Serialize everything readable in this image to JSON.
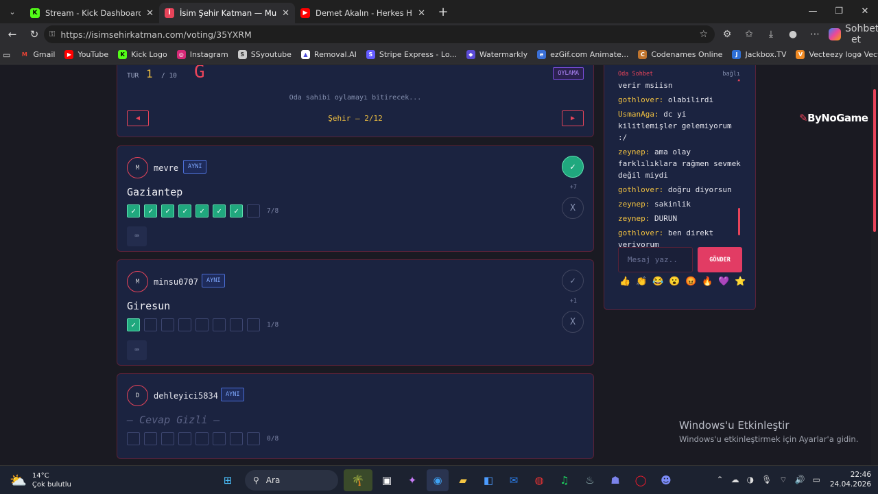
{
  "browser": {
    "tabs": [
      {
        "title": "Stream - Kick Dashboard",
        "icon": "kick-icon",
        "color": "#53fc18"
      },
      {
        "title": "İsim Şehir Katman — Multiplayer K",
        "icon": "site-icon",
        "color": "#e8445a"
      },
      {
        "title": "Demet Akalın - Herkes Hak Ettiği G",
        "icon": "youtube-icon",
        "color": "#ff0000"
      }
    ],
    "url": "https://isimsehirkatman.com/voting/35YXRM",
    "copilot_label": "Sohbet et",
    "bookmarks": [
      "Gmail",
      "YouTube",
      "Kick Logo",
      "Instagram",
      "SSyoutube",
      "Removal.AI",
      "Stripe Express - Lo...",
      "Watermarkly",
      "ezGif.com Animate...",
      "Codenames Online",
      "Jackbox.TV",
      "Vecteezy logo Vect..."
    ]
  },
  "game": {
    "round_label": "TUR",
    "round_current": "1",
    "round_total": "/ 10",
    "letter": "G",
    "phase": "OYLAMA",
    "waiting_text": "Oda sahibi oylamayı bitirecek...",
    "prev_arrow": "◀",
    "next_arrow": "▶",
    "category": "Şehir — 2/12"
  },
  "players": [
    {
      "initial": "M",
      "name": "mevre",
      "badge": "AYNI",
      "answer": "Gaziantep",
      "votes_yes": 7,
      "score": "7/8",
      "plus": "+7",
      "yes_active": true,
      "hidden": false
    },
    {
      "initial": "M",
      "name": "minsu0707",
      "badge": "AYNI",
      "answer": "Giresun",
      "votes_yes": 1,
      "score": "1/8",
      "plus": "+1",
      "yes_active": false,
      "hidden": false
    },
    {
      "initial": "D",
      "name": "dehleyici5834",
      "badge": "AYNI",
      "answer": "— Cevap Gizli —",
      "votes_yes": 0,
      "score": "0/8",
      "plus": "",
      "yes_active": false,
      "hidden": true
    }
  ],
  "vote_yes_symbol": "✓",
  "vote_no_symbol": "X",
  "keyboard_icon": "⌨",
  "chat": {
    "title": "Oda Sohbet",
    "status": "bağlı",
    "messages": [
      {
        "user": "",
        "text": "verir msiisn"
      },
      {
        "user": "gothlover:",
        "text": "olabilirdi"
      },
      {
        "user": "UsmanAga:",
        "text": "dc yi kilitlemişler gelemiyorum :/"
      },
      {
        "user": "zeynep:",
        "text": "ama olay farklılıklara rağmen sevmek değil miydi"
      },
      {
        "user": "gothlover:",
        "text": "doğru diyorsun"
      },
      {
        "user": "zeynep:",
        "text": "sakinlik"
      },
      {
        "user": "zeynep:",
        "text": "DURUN"
      },
      {
        "user": "gothlover:",
        "text": "ben direkt veriyorum"
      }
    ],
    "input_placeholder": "Mesaj yaz..",
    "send_label": "GÖNDER",
    "emojis": [
      "👍",
      "👏",
      "😂",
      "😮",
      "😡",
      "🔥",
      "💜",
      "⭐"
    ]
  },
  "overlay": {
    "brand": "ByNoGame",
    "activate_title": "Windows'u Etkinleştir",
    "activate_sub": "Windows'u etkinleştirmek için Ayarlar'a gidin."
  },
  "taskbar": {
    "temp": "14°C",
    "weather": "Çok bulutlu",
    "search": "Ara",
    "time": "22:46",
    "date": "24.04.2026"
  }
}
